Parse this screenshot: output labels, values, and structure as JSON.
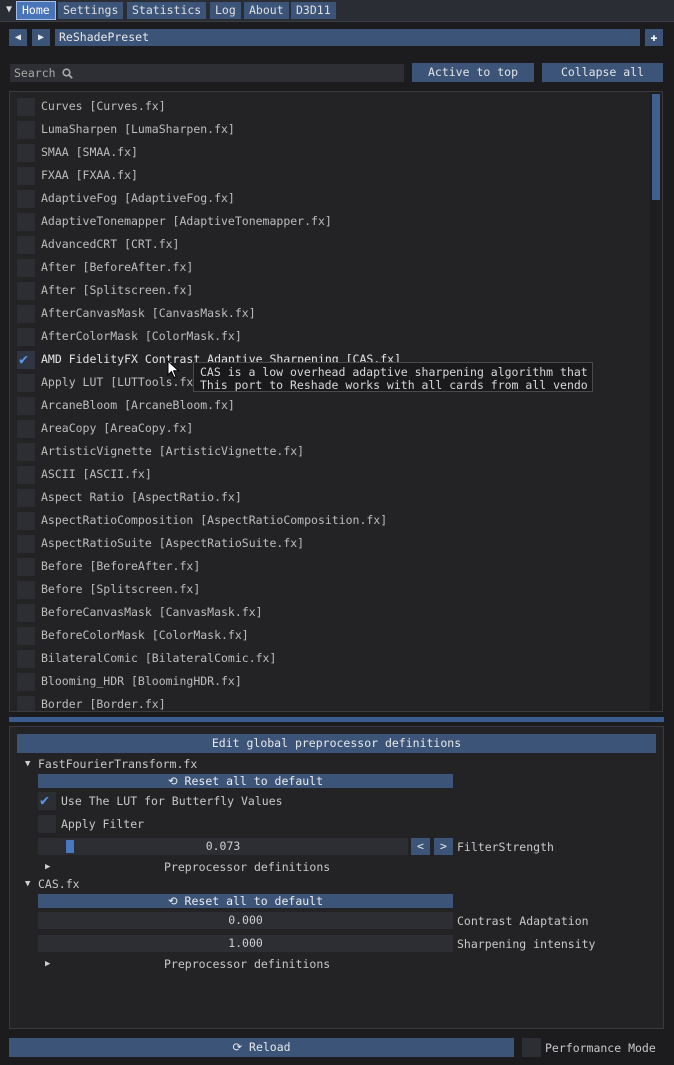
{
  "menu": {
    "tabs": [
      {
        "label": "Home"
      },
      {
        "label": "Settings"
      },
      {
        "label": "Statistics"
      },
      {
        "label": "Log"
      },
      {
        "label": "About"
      },
      {
        "label": "D3D11"
      }
    ]
  },
  "preset": {
    "name": "ReShadePreset"
  },
  "search": {
    "placeholder": "Search"
  },
  "buttons": {
    "active_to_top": "Active to top",
    "collapse_all": "Collapse all"
  },
  "effects": [
    {
      "label": "Curves [Curves.fx]",
      "checked": false
    },
    {
      "label": "LumaSharpen [LumaSharpen.fx]",
      "checked": false
    },
    {
      "label": "SMAA [SMAA.fx]",
      "checked": false
    },
    {
      "label": "FXAA [FXAA.fx]",
      "checked": false
    },
    {
      "label": "AdaptiveFog [AdaptiveFog.fx]",
      "checked": false
    },
    {
      "label": "AdaptiveTonemapper [AdaptiveTonemapper.fx]",
      "checked": false
    },
    {
      "label": "AdvancedCRT [CRT.fx]",
      "checked": false
    },
    {
      "label": "After [BeforeAfter.fx]",
      "checked": false
    },
    {
      "label": "After [Splitscreen.fx]",
      "checked": false
    },
    {
      "label": "AfterCanvasMask [CanvasMask.fx]",
      "checked": false
    },
    {
      "label": "AfterColorMask [ColorMask.fx]",
      "checked": false
    },
    {
      "label": "AMD FidelityFX Contrast Adaptive Sharpening [CAS.fx]",
      "checked": true
    },
    {
      "label": "Apply LUT [LUTTools.fx]",
      "checked": false
    },
    {
      "label": "ArcaneBloom [ArcaneBloom.fx]",
      "checked": false
    },
    {
      "label": "AreaCopy [AreaCopy.fx]",
      "checked": false
    },
    {
      "label": "ArtisticVignette [ArtisticVignette.fx]",
      "checked": false
    },
    {
      "label": "ASCII [ASCII.fx]",
      "checked": false
    },
    {
      "label": "Aspect Ratio [AspectRatio.fx]",
      "checked": false
    },
    {
      "label": "AspectRatioComposition [AspectRatioComposition.fx]",
      "checked": false
    },
    {
      "label": "AspectRatioSuite [AspectRatioSuite.fx]",
      "checked": false
    },
    {
      "label": "Before [BeforeAfter.fx]",
      "checked": false
    },
    {
      "label": "Before [Splitscreen.fx]",
      "checked": false
    },
    {
      "label": "BeforeCanvasMask [CanvasMask.fx]",
      "checked": false
    },
    {
      "label": "BeforeColorMask [ColorMask.fx]",
      "checked": false
    },
    {
      "label": "BilateralComic [BilateralComic.fx]",
      "checked": false
    },
    {
      "label": "Blooming_HDR [BloomingHDR.fx]",
      "checked": false
    },
    {
      "label": "Border [Border.fx]",
      "checked": false
    }
  ],
  "tooltip": {
    "line1": "CAS is a low overhead adaptive sharpening algorithm that",
    "line2": "This port to Reshade works with all cards from all vendo"
  },
  "settings": {
    "edit_global": "Edit global preprocessor definitions",
    "fft": {
      "title": "FastFourierTransform.fx",
      "reset": "Reset all to default",
      "use_lut_label": "Use The LUT for Butterfly Values",
      "use_lut_checked": true,
      "apply_filter_label": "Apply Filter",
      "apply_filter_checked": false,
      "filter_strength_value": "0.073",
      "filter_strength_label": "FilterStrength",
      "step_down": "<",
      "step_up": ">",
      "preproc": "Preprocessor definitions"
    },
    "cas": {
      "title": "CAS.fx",
      "reset": "Reset all to default",
      "contrast_value": "0.000",
      "contrast_label": "Contrast Adaptation",
      "sharpening_value": "1.000",
      "sharpening_label": "Sharpening intensity",
      "preproc": "Preprocessor definitions"
    }
  },
  "bottom": {
    "reload": "Reload",
    "performance_mode": "Performance Mode",
    "performance_checked": false
  },
  "colors": {
    "accent": "#3c5478",
    "active_tab": "#4a74b8",
    "check": "#5a97e6",
    "background": "#1c1c1e"
  }
}
